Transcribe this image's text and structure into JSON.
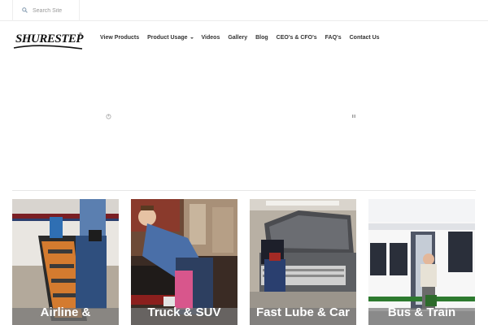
{
  "search": {
    "placeholder": "Search Site"
  },
  "logo": {
    "text": "SHURESTEP",
    "mark": "®"
  },
  "nav": {
    "items": [
      {
        "label": "View Products"
      },
      {
        "label": "Product Usage",
        "has_dropdown": true
      },
      {
        "label": "Videos"
      },
      {
        "label": "Gallery"
      },
      {
        "label": "Blog"
      },
      {
        "label": "CEO's & CFO's"
      },
      {
        "label": "FAQ's"
      },
      {
        "label": "Contact Us"
      }
    ]
  },
  "tiles": [
    {
      "title": "Airline &"
    },
    {
      "title": "Truck & SUV"
    },
    {
      "title": "Fast Lube & Car"
    },
    {
      "title": "Bus & Train"
    }
  ],
  "colors": {
    "text": "#333333",
    "band": "#787878",
    "border": "#e6e6e6"
  }
}
